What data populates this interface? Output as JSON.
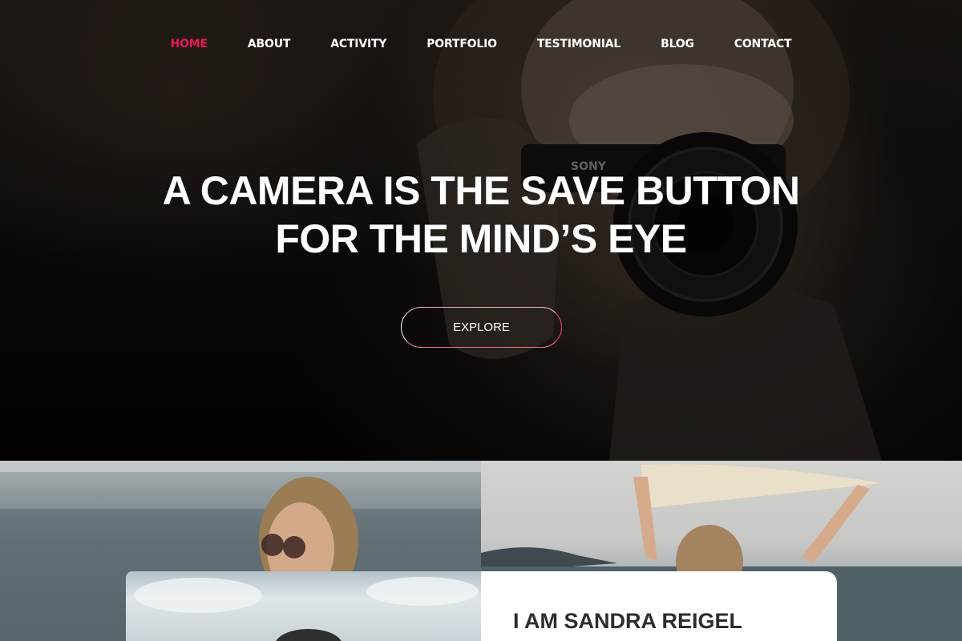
{
  "nav": {
    "items": [
      {
        "label": "HOME",
        "active": true
      },
      {
        "label": "ABOUT",
        "active": false
      },
      {
        "label": "ACTIVITY",
        "active": false
      },
      {
        "label": "PORTFOLIO",
        "active": false
      },
      {
        "label": "TESTIMONIAL",
        "active": false
      },
      {
        "label": "BLOG",
        "active": false
      },
      {
        "label": "CONTACT",
        "active": false
      }
    ]
  },
  "hero": {
    "title_line1": "A CAMERA IS THE SAVE BUTTON",
    "title_line2": "FOR THE MIND’S EYE",
    "cta_label": "EXPLORE"
  },
  "about": {
    "title": "I AM SANDRA REIGEL"
  },
  "colors": {
    "accent": "#e8185a",
    "hero_text": "#ffffff",
    "card_background": "#ffffff",
    "heading_dark": "#2d2d2d"
  }
}
